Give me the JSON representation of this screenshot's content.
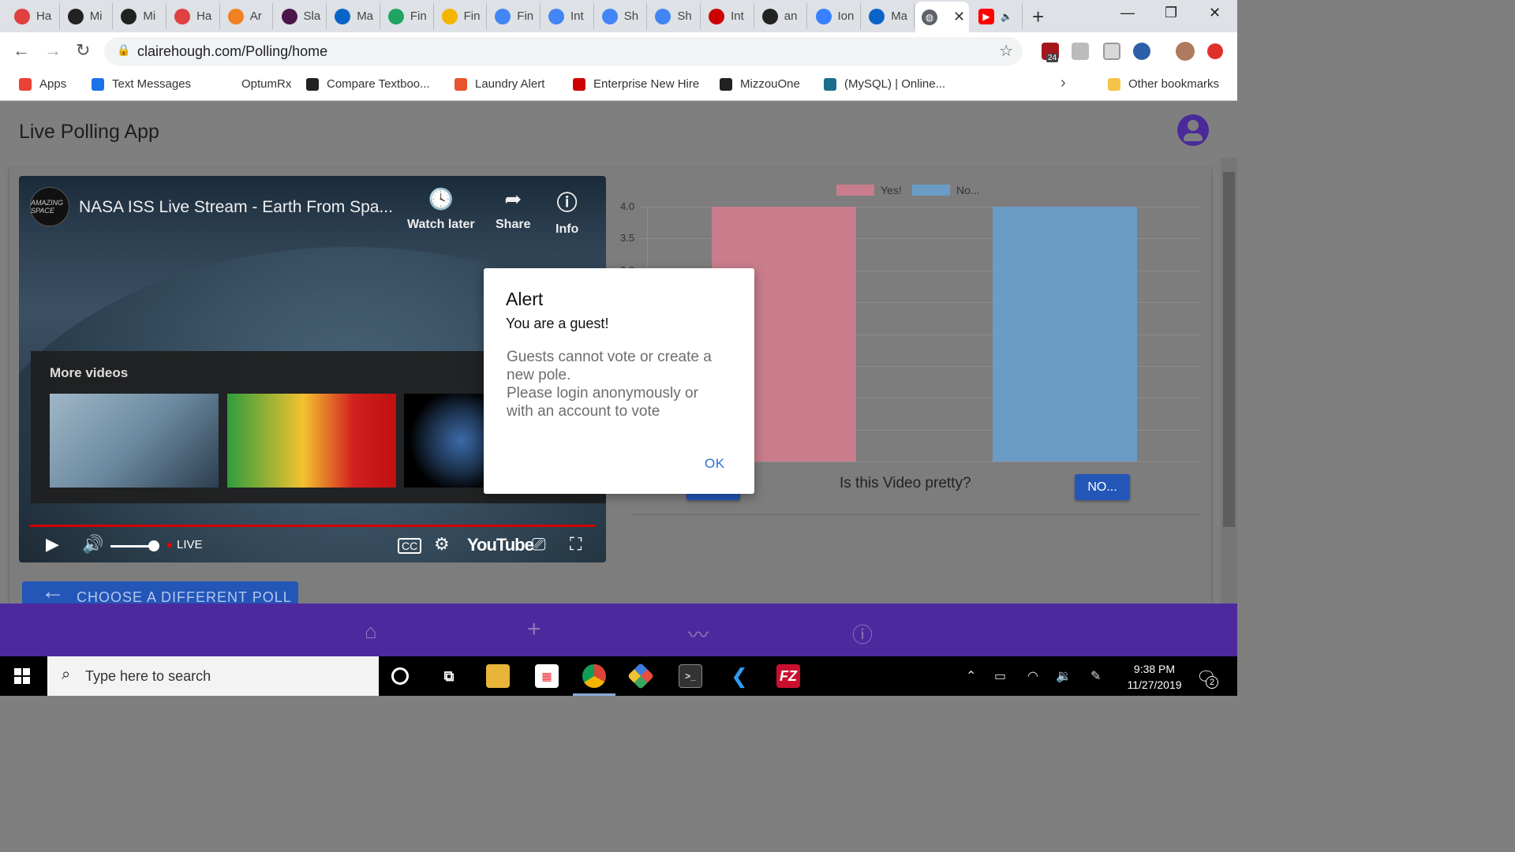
{
  "browser": {
    "tabs": [
      {
        "label": "Ha",
        "color": "#e04040"
      },
      {
        "label": "Mi",
        "color": "#222222"
      },
      {
        "label": "Mi",
        "color": "#222222"
      },
      {
        "label": "Ha",
        "color": "#e04040"
      },
      {
        "label": "Ar",
        "color": "#f08020"
      },
      {
        "label": "Sla",
        "color": "#4a154b"
      },
      {
        "label": "Ma",
        "color": "#0a64c8"
      },
      {
        "label": "Fin",
        "color": "#1fa463"
      },
      {
        "label": "Fin",
        "color": "#f4b400"
      },
      {
        "label": "Fin",
        "color": "#4285f4"
      },
      {
        "label": "Int",
        "color": "#4285f4"
      },
      {
        "label": "Sh",
        "color": "#4285f4"
      },
      {
        "label": "Sh",
        "color": "#4285f4"
      },
      {
        "label": "Int",
        "color": "#cc0000"
      },
      {
        "label": "an",
        "color": "#222222"
      },
      {
        "label": "Ion",
        "color": "#3880ff"
      },
      {
        "label": "Ma",
        "color": "#0a64c8"
      }
    ],
    "url": "clairehough.com/Polling/home",
    "extension_badge": "24"
  },
  "bookmarks": [
    {
      "label": "Apps",
      "color": "#ea4335"
    },
    {
      "label": "Text Messages",
      "color": "#1a73e8"
    },
    {
      "label": "OptumRx",
      "color": "#ffffff"
    },
    {
      "label": "Compare Textboo...",
      "color": "#222222"
    },
    {
      "label": "Laundry Alert",
      "color": "#e8542c"
    },
    {
      "label": "Enterprise New Hire",
      "color": "#cc0000"
    },
    {
      "label": "MizzouOne",
      "color": "#222222"
    },
    {
      "label": "(MySQL) | Online...",
      "color": "#1a6e8c"
    }
  ],
  "other_bookmarks": "Other bookmarks",
  "app": {
    "title": "Live Polling App",
    "accent": "#4c2a9e",
    "button_color": "#2456b8"
  },
  "video": {
    "channel_logo": "AMAZING SPACE",
    "title": "NASA ISS Live Stream - Earth From Spa...",
    "actions": [
      "Watch later",
      "Share",
      "Info"
    ],
    "more_videos": "More videos",
    "live_label": "LIVE",
    "youtube_logo": "YouTube"
  },
  "chart_data": {
    "type": "bar",
    "categories": [
      "Yes!",
      "No..."
    ],
    "series": [
      {
        "name": "Yes!",
        "values": [
          4,
          null
        ],
        "color": "#c97d8c"
      },
      {
        "name": "No...",
        "values": [
          null,
          4
        ],
        "color": "#6b9cc6"
      }
    ],
    "yticks": [
      "4.0",
      "3.5",
      "3.0"
    ],
    "ylim": [
      0,
      4
    ],
    "legend": "top",
    "grid": true
  },
  "poll": {
    "question": "Is this Video pretty?",
    "no_label": "NO..."
  },
  "choose_poll_label": "CHOOSE A DIFFERENT POLL",
  "modal": {
    "title": "Alert",
    "subtitle": "You are a guest!",
    "message_lines": [
      "Guests cannot vote or create a",
      "new pole.",
      "Please login anonymously or",
      "with an account to vote"
    ],
    "ok_label": "OK"
  },
  "taskbar": {
    "search_placeholder": "Type here to search",
    "time": "9:38 PM",
    "date": "11/27/2019",
    "notification_count": "2"
  }
}
